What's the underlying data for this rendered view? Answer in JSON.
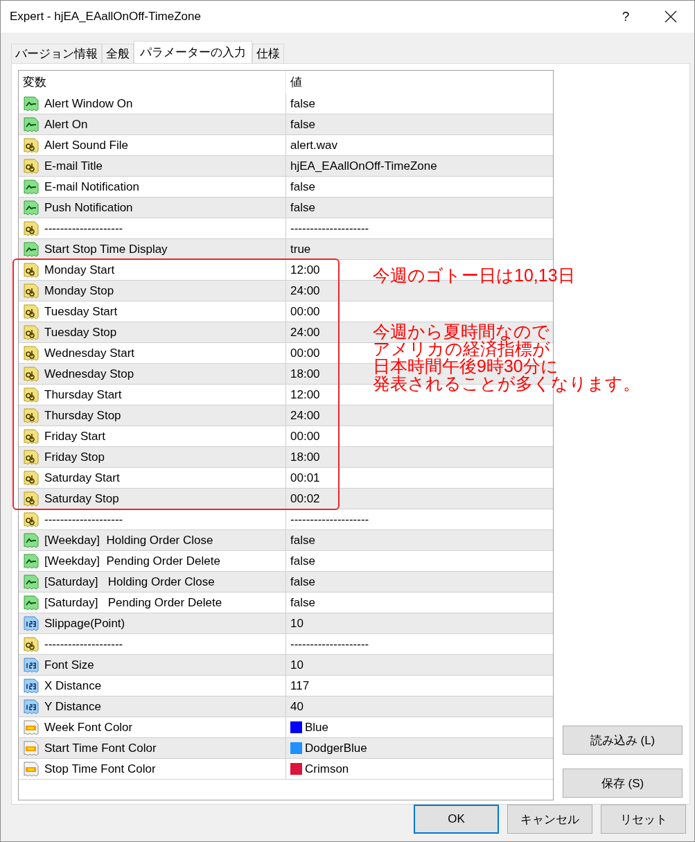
{
  "window": {
    "title": "Expert - hjEA_EAallOnOff-TimeZone"
  },
  "tabs": [
    {
      "label": "バージョン情報",
      "selected": false
    },
    {
      "label": "全般",
      "selected": false
    },
    {
      "label": "パラメーターの入力",
      "selected": true
    },
    {
      "label": "仕様",
      "selected": false
    }
  ],
  "table": {
    "columns": [
      "変数",
      "値"
    ],
    "rows": [
      {
        "kind": "bool",
        "name": "Alert Window On",
        "value": "false"
      },
      {
        "kind": "bool",
        "name": "Alert On",
        "value": "false"
      },
      {
        "kind": "string",
        "name": "Alert Sound File",
        "value": "alert.wav"
      },
      {
        "kind": "string",
        "name": "E-mail Title",
        "value": "hjEA_EAallOnOff-TimeZone"
      },
      {
        "kind": "bool",
        "name": "E-mail Notification",
        "value": "false"
      },
      {
        "kind": "bool",
        "name": "Push Notification",
        "value": "false"
      },
      {
        "kind": "string",
        "name": "--------------------",
        "value": "--------------------"
      },
      {
        "kind": "bool",
        "name": "Start Stop Time Display",
        "value": "true"
      },
      {
        "kind": "string",
        "name": "Monday Start",
        "value": "12:00"
      },
      {
        "kind": "string",
        "name": "Monday Stop",
        "value": "24:00"
      },
      {
        "kind": "string",
        "name": "Tuesday Start",
        "value": "00:00"
      },
      {
        "kind": "string",
        "name": "Tuesday Stop",
        "value": "24:00"
      },
      {
        "kind": "string",
        "name": "Wednesday Start",
        "value": "00:00"
      },
      {
        "kind": "string",
        "name": "Wednesday Stop",
        "value": "18:00"
      },
      {
        "kind": "string",
        "name": "Thursday Start",
        "value": "12:00"
      },
      {
        "kind": "string",
        "name": "Thursday Stop",
        "value": "24:00"
      },
      {
        "kind": "string",
        "name": "Friday Start",
        "value": "00:00"
      },
      {
        "kind": "string",
        "name": "Friday Stop",
        "value": "18:00"
      },
      {
        "kind": "string",
        "name": "Saturday Start",
        "value": "00:01"
      },
      {
        "kind": "string",
        "name": "Saturday Stop",
        "value": "00:02"
      },
      {
        "kind": "string",
        "name": "--------------------",
        "value": "--------------------"
      },
      {
        "kind": "bool",
        "name": "[Weekday]  Holding Order Close",
        "value": "false"
      },
      {
        "kind": "bool",
        "name": "[Weekday]  Pending Order Delete",
        "value": "false"
      },
      {
        "kind": "bool",
        "name": "[Saturday]   Holding Order Close",
        "value": "false"
      },
      {
        "kind": "bool",
        "name": "[Saturday]   Pending Order Delete",
        "value": "false"
      },
      {
        "kind": "int",
        "name": "Slippage(Point)",
        "value": "10"
      },
      {
        "kind": "string",
        "name": "--------------------",
        "value": "--------------------"
      },
      {
        "kind": "int",
        "name": "Font Size",
        "value": "10"
      },
      {
        "kind": "int",
        "name": "X Distance",
        "value": "117"
      },
      {
        "kind": "int",
        "name": "Y Distance",
        "value": "40"
      },
      {
        "kind": "color",
        "name": "Week Font Color",
        "value": "Blue",
        "color": "#0000ff"
      },
      {
        "kind": "color",
        "name": "Start Time Font Color",
        "value": "DodgerBlue",
        "color": "#1e90ff"
      },
      {
        "kind": "color",
        "name": "Stop Time Font Color",
        "value": "Crimson",
        "color": "#dc143c"
      }
    ]
  },
  "notes": [
    "今週のゴトー日は10,13日",
    "今週から夏時間なので",
    "アメリカの経済指標が",
    "日本時間午後9時30分に",
    "発表されることが多くなります。"
  ],
  "side_buttons": [
    "読み込み (L)",
    "保存 (S)"
  ],
  "buttons": [
    "OK",
    "キャンセル",
    "リセット"
  ],
  "title_buttons": [
    "?"
  ]
}
